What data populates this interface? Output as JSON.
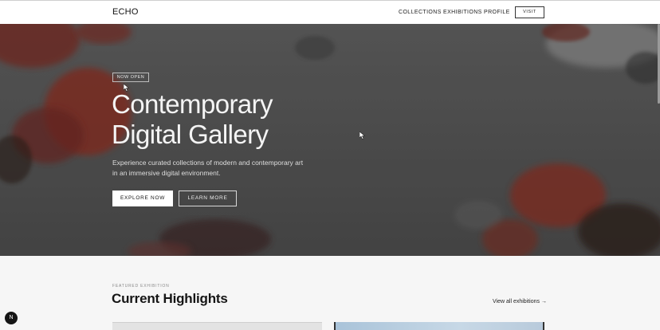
{
  "header": {
    "brand": "ECHO",
    "nav": {
      "collections": "COLLECTIONS",
      "exhibitions": "EXHIBITIONS",
      "profile": "PROFILE"
    },
    "visit_label": "VISIT"
  },
  "hero": {
    "badge": "NOW OPEN",
    "title_line1": "Contemporary",
    "title_line2": "Digital Gallery",
    "description": "Experience curated collections of modern and contemporary art in an immersive digital environment.",
    "primary_cta": "EXPLORE NOW",
    "secondary_cta": "LEARN MORE"
  },
  "featured": {
    "eyebrow": "FEATURED EXHIBITION",
    "title": "Current Highlights",
    "view_all": "View all exhibitions →"
  },
  "floating": {
    "avatar_letter": "N"
  },
  "colors": {
    "accent_red": "#8a2a22",
    "hero_gray": "#555555",
    "page_bg": "#f6f6f6"
  }
}
